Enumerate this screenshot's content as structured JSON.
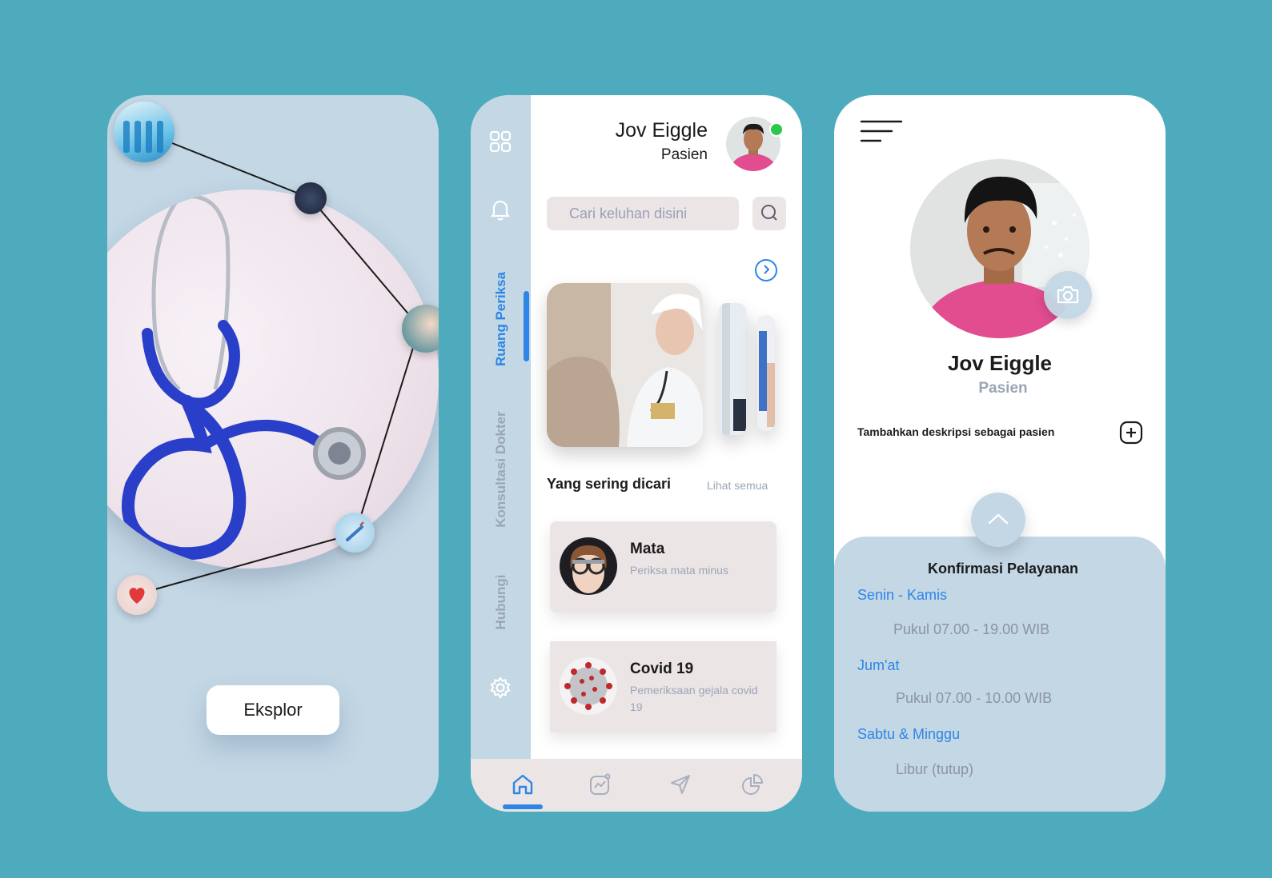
{
  "colors": {
    "background": "#4eabbd",
    "panel": "#c3d7e5",
    "accent": "#2d86e6",
    "muted": "#9aa6b6",
    "card": "#ece5e6",
    "online": "#2cc84a"
  },
  "intro": {
    "explore_button": "Eksplor"
  },
  "home": {
    "user": {
      "name": "Jov Eiggle",
      "role": "Pasien",
      "status": "online"
    },
    "sidebar": {
      "tabs": [
        {
          "label": "Ruang Periksa",
          "active": true
        },
        {
          "label": "Konsultasi Dokter",
          "active": false
        },
        {
          "label": "Hubungi",
          "active": false
        }
      ],
      "icons": [
        "grid-icon",
        "bell-icon",
        "settings-icon"
      ]
    },
    "search": {
      "placeholder": "Cari keluhan disini"
    },
    "section": {
      "title": "Yang sering dicari",
      "see_all": "Lihat semua"
    },
    "cards": [
      {
        "title": "Mata",
        "subtitle": "Periksa mata minus"
      },
      {
        "title": "Covid 19",
        "subtitle": "Pemeriksaan gejala covid 19"
      }
    ],
    "bottom_nav": [
      {
        "icon": "home-icon",
        "active": true
      },
      {
        "icon": "activity-icon",
        "active": false
      },
      {
        "icon": "send-icon",
        "active": false
      },
      {
        "icon": "pie-chart-icon",
        "active": false
      }
    ]
  },
  "profile": {
    "name": "Jov Eiggle",
    "role": "Pasien",
    "add_description": "Tambahkan deskripsi sebagai pasien",
    "confirmation": {
      "title": "Konfirmasi Pelayanan",
      "schedule": [
        {
          "day": "Senin - Kamis",
          "time": "Pukul 07.00 - 19.00 WIB"
        },
        {
          "day": "Jum'at",
          "time": "Pukul 07.00 - 10.00 WIB"
        },
        {
          "day": "Sabtu & Minggu",
          "time": "Libur (tutup)"
        }
      ]
    }
  }
}
